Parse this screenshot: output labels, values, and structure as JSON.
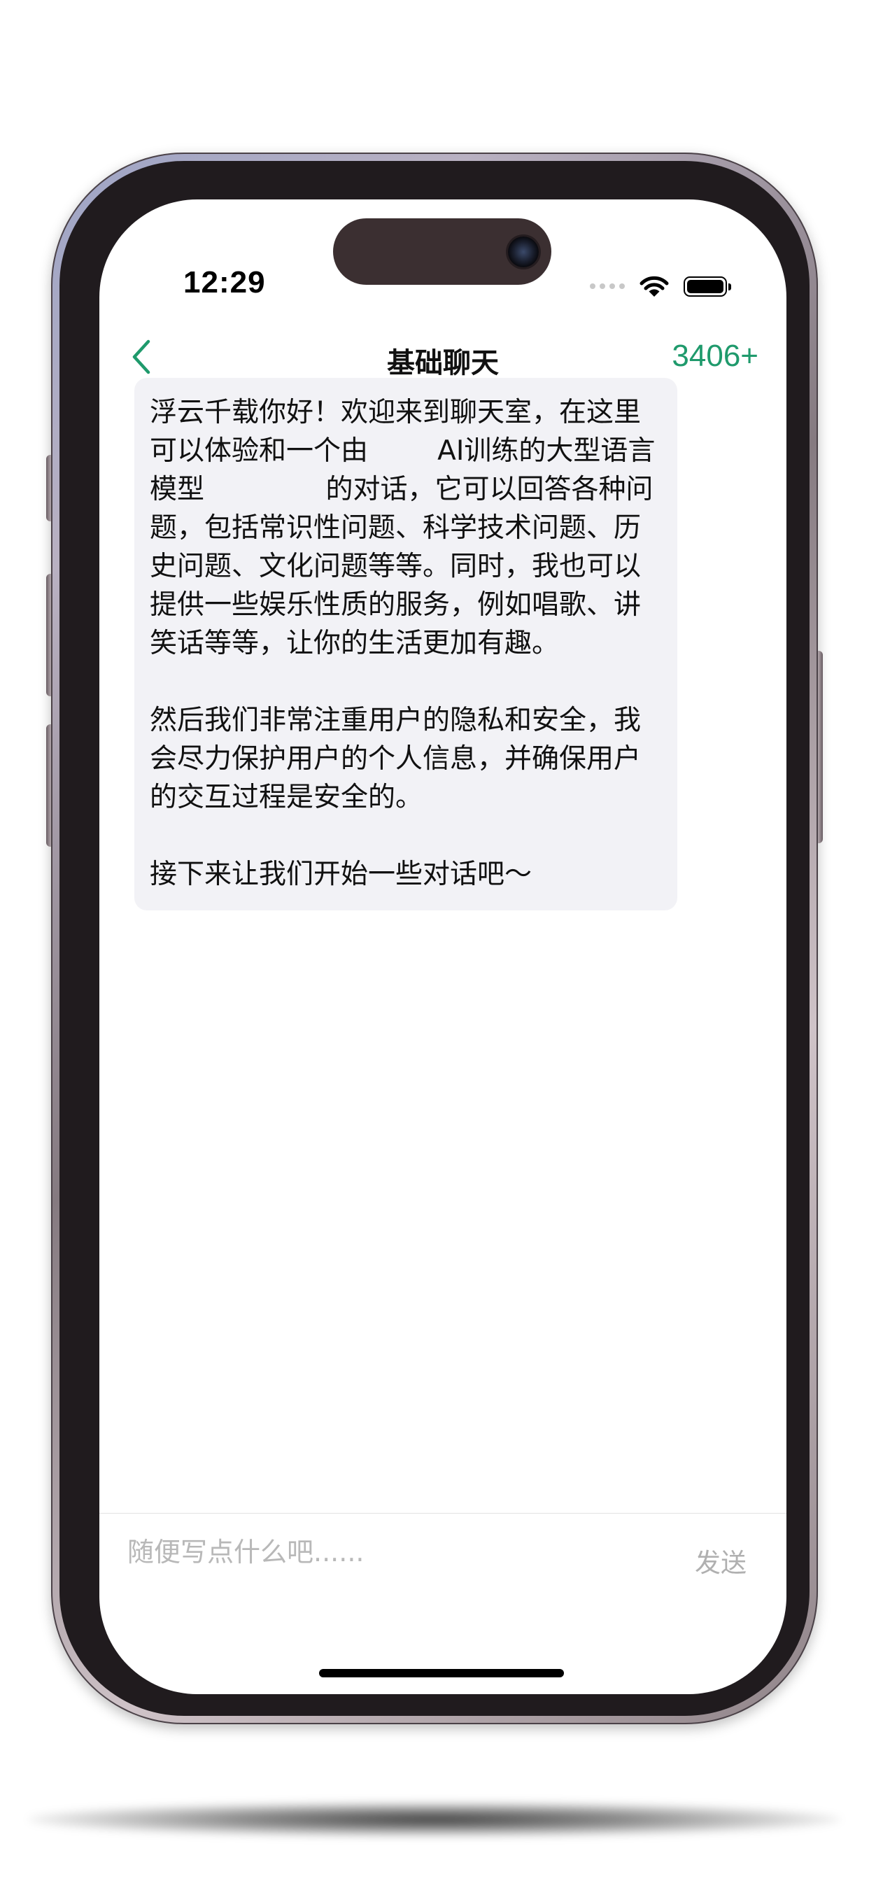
{
  "status_bar": {
    "time": "12:29"
  },
  "nav": {
    "back_icon": "chevron-left-icon",
    "title": "基础聊天",
    "count": "3406+"
  },
  "message": {
    "paragraphs": [
      "浮云千载你好！欢迎来到聊天室，在这里可以体验和一个由        AI训练的大型语言模型              的对话，它可以回答各种问题，包括常识性问题、科学技术问题、历史问题、文化问题等等。同时，我也可以提供一些娱乐性质的服务，例如唱歌、讲笑话等等，让你的生活更加有趣。",
      "然后我们非常注重用户的隐私和安全，我会尽力保护用户的个人信息，并确保用户的交互过程是安全的。",
      "接下来让我们开始一些对话吧～"
    ]
  },
  "composer": {
    "placeholder": "随便写点什么吧......",
    "value": "",
    "send_label": "发送"
  },
  "colors": {
    "accent": "#1f9a6c",
    "bubble": "#f2f2f6",
    "placeholder": "#b8b8b8"
  }
}
